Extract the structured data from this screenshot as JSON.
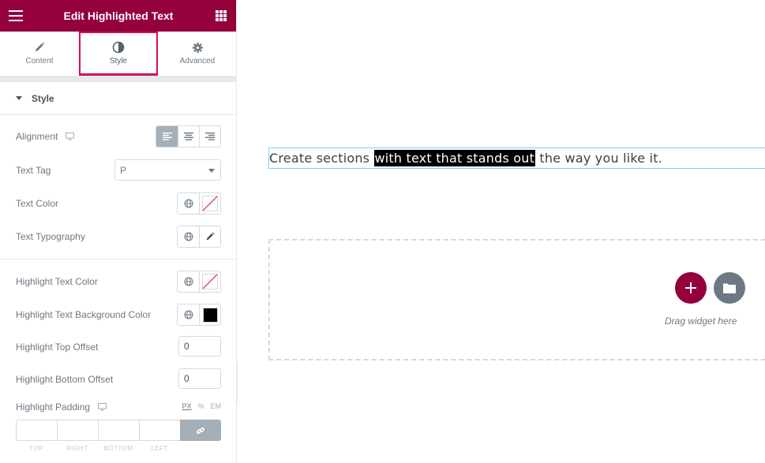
{
  "colors": {
    "brand": "#93003c",
    "accent": "#d30c5c",
    "widget_outline": "#71d7f7",
    "highlight_bg": "#000000"
  },
  "header": {
    "title": "Edit Highlighted Text",
    "menu_icon": "hamburger-icon",
    "apps_icon": "grid-icon"
  },
  "tabs": [
    {
      "label": "Content",
      "icon": "pencil-icon",
      "active": false
    },
    {
      "label": "Style",
      "icon": "contrast-icon",
      "active": true
    },
    {
      "label": "Advanced",
      "icon": "gear-icon",
      "active": false
    }
  ],
  "section": {
    "title": "Style"
  },
  "controls": {
    "alignment": {
      "label": "Alignment",
      "selected": "left"
    },
    "text_tag": {
      "label": "Text Tag",
      "value": "P"
    },
    "text_color": {
      "label": "Text Color"
    },
    "text_typography": {
      "label": "Text Typography"
    },
    "highlight_text_color": {
      "label": "Highlight Text Color"
    },
    "highlight_bg_color": {
      "label": "Highlight Text Background Color",
      "value": "#000000"
    },
    "highlight_top_offset": {
      "label": "Highlight Top Offset",
      "value": "0"
    },
    "highlight_bottom_offset": {
      "label": "Highlight Bottom Offset",
      "value": "0"
    },
    "highlight_padding": {
      "label": "Highlight Padding",
      "units": [
        "PX",
        "%",
        "EM"
      ],
      "selected_unit": "PX",
      "dimension_labels": [
        "TOP",
        "RIGHT",
        "BOTTOM",
        "LEFT"
      ]
    }
  },
  "preview": {
    "text_before": "Create sections ",
    "text_highlight": "with text that stands out",
    "text_after": " the way you like it.",
    "drop_text": "Drag widget here"
  }
}
